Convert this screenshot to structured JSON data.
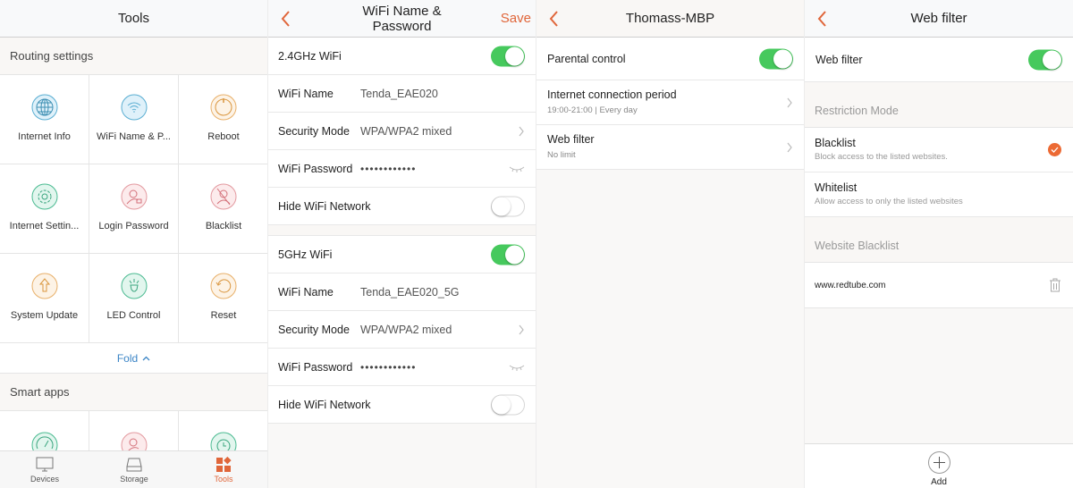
{
  "colors": {
    "accent": "#e0663a",
    "toggle_on": "#46c95d",
    "link_blue": "#3b85c6"
  },
  "tools_screen": {
    "title": "Tools",
    "routing_section": "Routing settings",
    "routing_items": [
      {
        "label": "Internet Info",
        "icon": "globe-icon"
      },
      {
        "label": "WiFi Name & P...",
        "icon": "wifi-icon"
      },
      {
        "label": "Reboot",
        "icon": "power-icon"
      },
      {
        "label": "Internet Settin...",
        "icon": "gear-icon"
      },
      {
        "label": "Login Password",
        "icon": "user-lock-icon"
      },
      {
        "label": "Blacklist",
        "icon": "user-blocked-icon"
      },
      {
        "label": "System Update",
        "icon": "upload-arrow-icon"
      },
      {
        "label": "LED Control",
        "icon": "led-light-icon"
      },
      {
        "label": "Reset",
        "icon": "reset-icon"
      }
    ],
    "fold_label": "Fold",
    "smart_section": "Smart apps",
    "smart_items": [
      {
        "icon": "speedometer-icon"
      },
      {
        "icon": "user-wifi-icon"
      },
      {
        "icon": "alarm-clock-icon"
      }
    ],
    "tabs": [
      {
        "label": "Devices",
        "icon": "monitor-icon",
        "active": false
      },
      {
        "label": "Storage",
        "icon": "storage-icon",
        "active": false
      },
      {
        "label": "Tools",
        "icon": "tools-grid-icon",
        "active": true
      }
    ]
  },
  "wifi_screen": {
    "title_line1": "WiFi Name &",
    "title_line2": "Password",
    "save_label": "Save",
    "band24": {
      "label": "2.4GHz WiFi",
      "enabled": true,
      "name_label": "WiFi Name",
      "name_value": "Tenda_EAE020",
      "security_label": "Security Mode",
      "security_value": "WPA/WPA2 mixed",
      "password_label": "WiFi Password",
      "password_value": "••••••••••••",
      "hide_label": "Hide WiFi Network",
      "hide_enabled": false
    },
    "band5": {
      "label": "5GHz WiFi",
      "enabled": true,
      "name_label": "WiFi Name",
      "name_value": "Tenda_EAE020_5G",
      "security_label": "Security Mode",
      "security_value": "WPA/WPA2 mixed",
      "password_label": "WiFi Password",
      "password_value": "••••••••••••",
      "hide_label": "Hide WiFi Network",
      "hide_enabled": false
    }
  },
  "device_screen": {
    "title": "Thomass-MBP",
    "parental_label": "Parental control",
    "parental_enabled": true,
    "period_label": "Internet connection period",
    "period_value": "19:00-21:00 | Every day",
    "webfilter_label": "Web filter",
    "webfilter_value": "No limit"
  },
  "webfilter_screen": {
    "title": "Web filter",
    "toggle_label": "Web filter",
    "toggle_enabled": true,
    "mode_header": "Restriction Mode",
    "modes": [
      {
        "title": "Blacklist",
        "desc": "Block access to the listed websites.",
        "selected": true
      },
      {
        "title": "Whitelist",
        "desc": "Allow access to only the listed websites",
        "selected": false
      }
    ],
    "list_header": "Website Blacklist",
    "sites": [
      "www.redtube.com"
    ],
    "add_label": "Add"
  }
}
